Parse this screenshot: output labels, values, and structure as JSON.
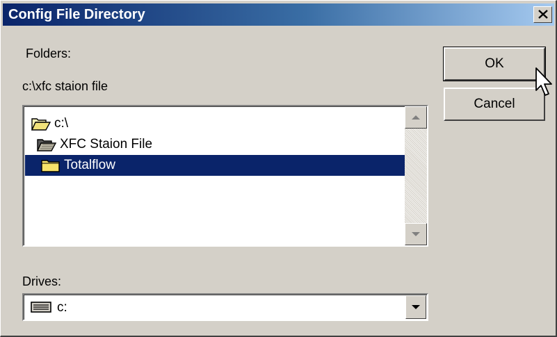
{
  "dialog": {
    "title": "Config File Directory",
    "close_glyph": "✕"
  },
  "folders": {
    "label": "Folders:",
    "current_path": "c:\\xfc staion file",
    "items": [
      {
        "label": "c:\\",
        "icon": "open-folder-icon"
      },
      {
        "label": "XFC Staion File",
        "icon": "open-folder-icon"
      },
      {
        "label": "Totalflow",
        "icon": "closed-folder-icon",
        "selected": true
      }
    ]
  },
  "buttons": {
    "ok_label": "OK",
    "cancel_label": "Cancel"
  },
  "drives": {
    "label": "Drives:",
    "selected": "c:",
    "icon": "drive-icon"
  },
  "colors": {
    "selection": "#0a246a",
    "title_gradient_start": "#0a246a",
    "title_gradient_end": "#a6caf0",
    "face": "#d4d0c8"
  },
  "cursor": "arrow-cursor-icon"
}
